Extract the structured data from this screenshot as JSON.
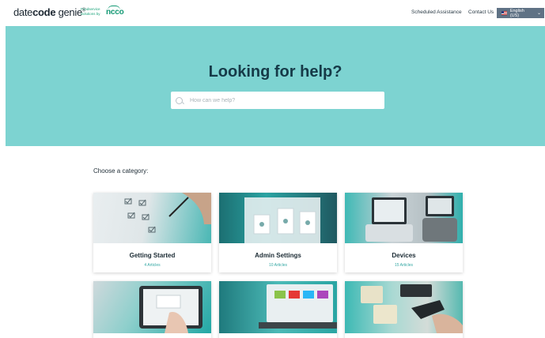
{
  "header": {
    "logo": {
      "pre": "date",
      "bold": "code",
      "post": " genie",
      "mark": "®"
    },
    "partner_line1": "Foodservice",
    "partner_line2": "Solutions by",
    "partner_brand": "ncco",
    "nav": [
      {
        "label": "Scheduled Assistance"
      },
      {
        "label": "Contact Us"
      }
    ],
    "language": "English (US)"
  },
  "hero": {
    "title": "Looking for help?",
    "search_placeholder": "How can we help?",
    "search_value": ""
  },
  "categories": {
    "heading": "Choose a category:",
    "cards": [
      {
        "title": "Getting Started",
        "count": "4 Articles",
        "image": "checklist-photo"
      },
      {
        "title": "Admin Settings",
        "count": "10 Articles",
        "image": "admin-laptop-photo"
      },
      {
        "title": "Devices",
        "count": "15 Articles",
        "image": "devices-printers-photo"
      },
      {
        "title": "",
        "count": "",
        "image": "tablet-hand-photo"
      },
      {
        "title": "",
        "count": "",
        "image": "laptop-app-photo"
      },
      {
        "title": "",
        "count": "",
        "image": "barcode-scanner-photo"
      }
    ]
  },
  "colors": {
    "hero_bg": "#7dd3d1",
    "title": "#163a48",
    "accent": "#35a8a4",
    "lang_bg": "#5f7285",
    "brand_green": "#129873"
  }
}
